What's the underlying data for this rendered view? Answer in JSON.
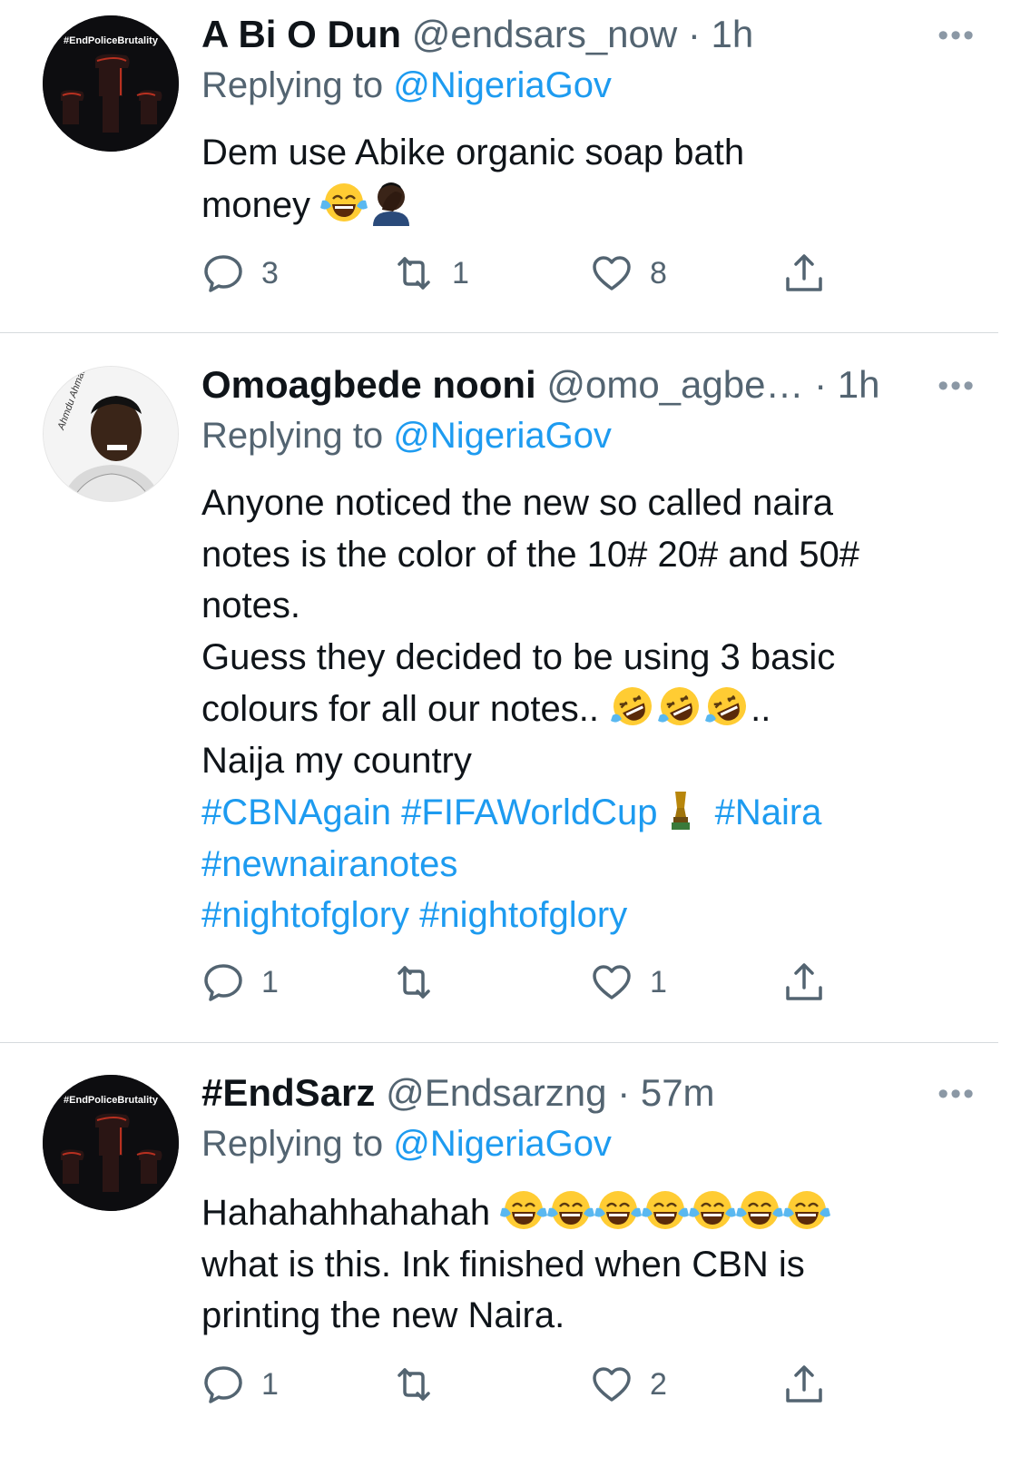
{
  "tweets": [
    {
      "name": "A Bi O Dun",
      "handle": "@endsars_now",
      "time": "· 1h",
      "replying_prefix": "Replying to",
      "replying_to": "@NigeriaGov",
      "avatar_text": "#EndPoliceBrutality",
      "body_lines": [
        "Dem  use Abike organic soap bath",
        "money"
      ],
      "emoji": [
        "face-with-tears-of-joy",
        "person-facepalming"
      ],
      "counts": {
        "replies": "3",
        "retweets": "1",
        "likes": "8"
      }
    },
    {
      "name": "Omoagbede nooni",
      "handle": "@omo_agbe…",
      "time": "· 1h",
      "replying_prefix": "Replying to",
      "replying_to": "@NigeriaGov",
      "body_lines": [
        "Anyone noticed the new so called naira",
        "notes is the color of the 10# 20# and 50#",
        "notes.",
        "Guess they decided to be using 3 basic",
        "colours for all our notes..",
        "..",
        "Naija my country"
      ],
      "hashtags": [
        "#CBNAgain",
        "#FIFAWorldCup",
        "#Naira",
        "#newnairanotes",
        "#nightofglory",
        "#nightofglory"
      ],
      "emoji": [
        "rolling-on-the-floor-laughing",
        "trophy"
      ],
      "counts": {
        "replies": "1",
        "retweets": "",
        "likes": "1"
      }
    },
    {
      "name": "#EndSarz",
      "handle": "@Endsarzng",
      "time": "· 57m",
      "replying_prefix": "Replying to",
      "replying_to": "@NigeriaGov",
      "avatar_text": "#EndPoliceBrutality",
      "body_lines": [
        "Hahahahhahahah",
        "what is this. Ink finished when CBN is",
        "printing the new Naira."
      ],
      "emoji": [
        "face-with-tears-of-joy"
      ],
      "counts": {
        "replies": "1",
        "retweets": "",
        "likes": "2"
      }
    }
  ],
  "more_label": "•••",
  "colors": {
    "link": "#1d9bf0",
    "muted": "#536471",
    "text": "#0f1419",
    "divider": "#d6dadd"
  }
}
